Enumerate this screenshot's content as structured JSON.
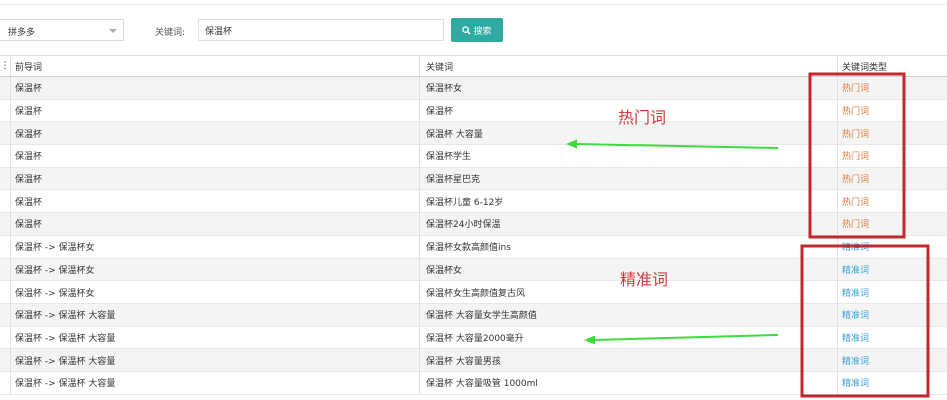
{
  "toolbar": {
    "platform_select": {
      "selected": "拼多多"
    },
    "keyword_label": "关键词:",
    "keyword_input": {
      "value": "保温杯"
    },
    "search_button": {
      "label": "搜索"
    }
  },
  "table": {
    "corner_glyph": "⋮",
    "columns": [
      "前导词",
      "关键词",
      "关键词类型"
    ],
    "rows": [
      {
        "lead": "保温杯",
        "keyword": "保温杯女",
        "type": "热门词",
        "type_kind": "hot"
      },
      {
        "lead": "保温杯",
        "keyword": "保温杯",
        "type": "热门词",
        "type_kind": "hot"
      },
      {
        "lead": "保温杯",
        "keyword": "保温杯 大容量",
        "type": "热门词",
        "type_kind": "hot"
      },
      {
        "lead": "保温杯",
        "keyword": "保温杯学生",
        "type": "热门词",
        "type_kind": "hot"
      },
      {
        "lead": "保温杯",
        "keyword": "保温杯星巴克",
        "type": "热门词",
        "type_kind": "hot"
      },
      {
        "lead": "保温杯",
        "keyword": "保温杯儿童 6-12岁",
        "type": "热门词",
        "type_kind": "hot"
      },
      {
        "lead": "保温杯",
        "keyword": "保温杯24小时保温",
        "type": "热门词",
        "type_kind": "hot"
      },
      {
        "lead": "保温杯 -> 保温杯女",
        "keyword": "保温杯女款高颜值ins",
        "type": "精准词",
        "type_kind": "exact"
      },
      {
        "lead": "保温杯 -> 保温杯女",
        "keyword": "保温杯女",
        "type": "精准词",
        "type_kind": "exact"
      },
      {
        "lead": "保温杯 -> 保温杯女",
        "keyword": "保温杯女生高颜值复古风",
        "type": "精准词",
        "type_kind": "exact"
      },
      {
        "lead": "保温杯 -> 保温杯 大容量",
        "keyword": "保温杯 大容量女学生高颜值",
        "type": "精准词",
        "type_kind": "exact"
      },
      {
        "lead": "保温杯 -> 保温杯 大容量",
        "keyword": "保温杯 大容量2000毫升",
        "type": "精准词",
        "type_kind": "exact"
      },
      {
        "lead": "保温杯 -> 保温杯 大容量",
        "keyword": "保温杯 大容量男孩",
        "type": "精准词",
        "type_kind": "exact"
      },
      {
        "lead": "保温杯 -> 保温杯 大容量",
        "keyword": "保温杯 大容量吸管 1000ml",
        "type": "精准词",
        "type_kind": "exact"
      }
    ]
  },
  "annotations": {
    "hot_label": "热门词",
    "exact_label": "精准词",
    "box_color": "#c0282d",
    "arrow_color": "#3ddc3d",
    "label_color": "#d23b3b"
  },
  "colors": {
    "accent": "#2fa9a2",
    "hot_text": "#e07a3a",
    "exact_text": "#3aa0d8"
  }
}
